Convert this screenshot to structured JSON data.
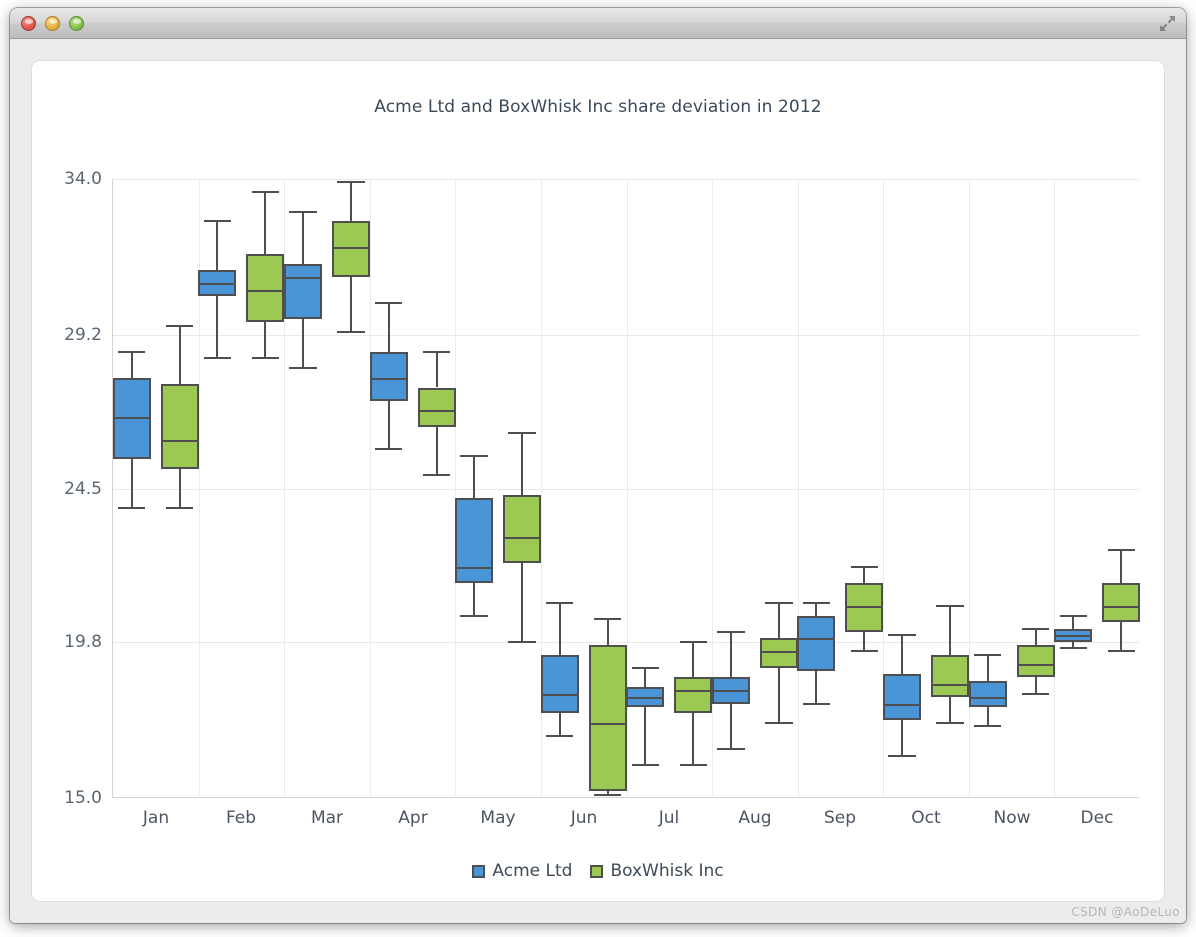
{
  "window": {
    "traffic_lights": {
      "close_label": "Close",
      "minimize_label": "Minimize",
      "zoom_label": "Zoom"
    },
    "fullscreen_label": "Enter Full Screen"
  },
  "watermark": "CSDN @AoDeLuo",
  "legend": {
    "position": "bottom-center",
    "items": [
      {
        "label": "Acme Ltd",
        "color": "#4a95d8"
      },
      {
        "label": "BoxWhisk Inc",
        "color": "#9bc954"
      }
    ]
  },
  "chart_data": {
    "type": "box",
    "title": "Acme Ltd and BoxWhisk Inc share deviation in 2012",
    "xlabel": "",
    "ylabel": "",
    "ylim": [
      15.0,
      34.0
    ],
    "yticks": [
      15.0,
      19.8,
      24.5,
      29.2,
      34.0
    ],
    "ytick_labels": [
      "15.0",
      "19.8",
      "24.5",
      "29.2",
      "34.0"
    ],
    "grid": true,
    "categories": [
      "Jan",
      "Feb",
      "Mar",
      "Apr",
      "May",
      "Jun",
      "Jul",
      "Aug",
      "Sep",
      "Oct",
      "Now",
      "Dec"
    ],
    "series": [
      {
        "name": "Acme Ltd",
        "color": "#4a95d8",
        "boxes": [
          {
            "category": "Jan",
            "low": 23.9,
            "q1": 25.4,
            "median": 26.7,
            "q3": 27.9,
            "high": 28.7
          },
          {
            "category": "Feb",
            "low": 28.5,
            "q1": 30.4,
            "median": 30.8,
            "q3": 31.2,
            "high": 32.7
          },
          {
            "category": "Mar",
            "low": 28.2,
            "q1": 29.7,
            "median": 31.0,
            "q3": 31.4,
            "high": 33.0
          },
          {
            "category": "Apr",
            "low": 25.7,
            "q1": 27.2,
            "median": 27.9,
            "q3": 28.7,
            "high": 30.2
          },
          {
            "category": "May",
            "low": 20.6,
            "q1": 21.6,
            "median": 22.1,
            "q3": 24.2,
            "high": 25.5
          },
          {
            "category": "Jun",
            "low": 16.9,
            "q1": 17.6,
            "median": 18.2,
            "q3": 19.4,
            "high": 21.0
          },
          {
            "category": "Jul",
            "low": 16.0,
            "q1": 17.8,
            "median": 18.1,
            "q3": 18.4,
            "high": 19.0
          },
          {
            "category": "Aug",
            "low": 16.5,
            "q1": 17.9,
            "median": 18.3,
            "q3": 18.7,
            "high": 20.1
          },
          {
            "category": "Sep",
            "low": 17.9,
            "q1": 18.9,
            "median": 19.9,
            "q3": 20.6,
            "high": 21.0
          },
          {
            "category": "Oct",
            "low": 16.3,
            "q1": 17.4,
            "median": 17.9,
            "q3": 18.8,
            "high": 20.0
          },
          {
            "category": "Now",
            "low": 17.2,
            "q1": 17.8,
            "median": 18.1,
            "q3": 18.6,
            "high": 19.4
          },
          {
            "category": "Dec",
            "low": 19.6,
            "q1": 19.8,
            "median": 20.0,
            "q3": 20.2,
            "high": 20.6
          }
        ]
      },
      {
        "name": "BoxWhisk Inc",
        "color": "#9bc954",
        "boxes": [
          {
            "category": "Jan",
            "low": 23.9,
            "q1": 25.1,
            "median": 26.0,
            "q3": 27.7,
            "high": 29.5
          },
          {
            "category": "Feb",
            "low": 28.5,
            "q1": 29.6,
            "median": 30.6,
            "q3": 31.7,
            "high": 33.6
          },
          {
            "category": "Mar",
            "low": 29.3,
            "q1": 31.0,
            "median": 31.9,
            "q3": 32.7,
            "high": 33.9
          },
          {
            "category": "Apr",
            "low": 24.9,
            "q1": 26.4,
            "median": 26.9,
            "q3": 27.6,
            "high": 28.7
          },
          {
            "category": "May",
            "low": 19.8,
            "q1": 22.2,
            "median": 23.0,
            "q3": 24.3,
            "high": 26.2
          },
          {
            "category": "Jun",
            "low": 15.1,
            "q1": 15.2,
            "median": 17.3,
            "q3": 19.7,
            "high": 20.5
          },
          {
            "category": "Jul",
            "low": 16.0,
            "q1": 17.6,
            "median": 18.3,
            "q3": 18.7,
            "high": 19.8
          },
          {
            "category": "Aug",
            "low": 17.3,
            "q1": 19.0,
            "median": 19.5,
            "q3": 19.9,
            "high": 21.0
          },
          {
            "category": "Sep",
            "low": 19.5,
            "q1": 20.1,
            "median": 20.9,
            "q3": 21.6,
            "high": 22.1
          },
          {
            "category": "Oct",
            "low": 17.3,
            "q1": 18.1,
            "median": 18.5,
            "q3": 19.4,
            "high": 20.9
          },
          {
            "category": "Now",
            "low": 18.2,
            "q1": 18.7,
            "median": 19.1,
            "q3": 19.7,
            "high": 20.2
          },
          {
            "category": "Dec",
            "low": 19.5,
            "q1": 20.4,
            "median": 20.9,
            "q3": 21.6,
            "high": 22.6
          }
        ]
      }
    ]
  }
}
